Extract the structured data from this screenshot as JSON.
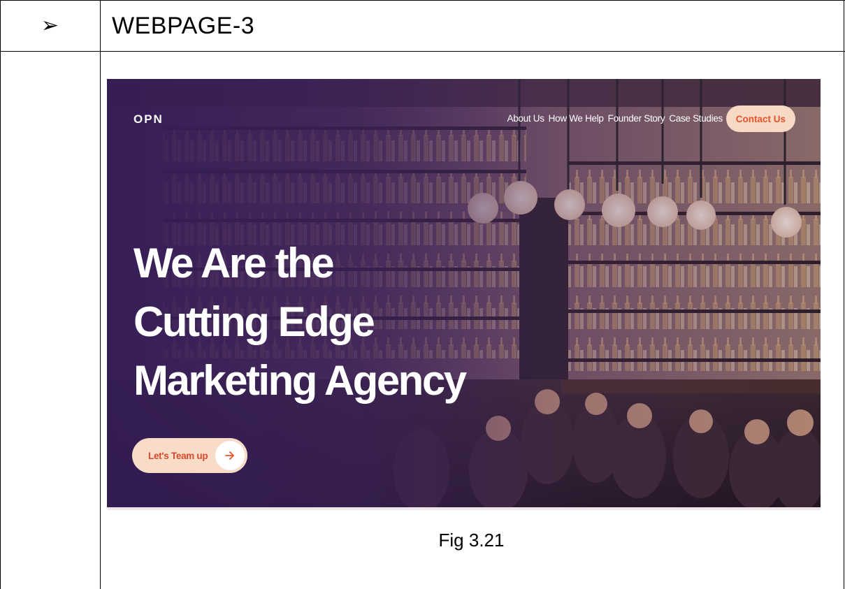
{
  "document": {
    "bullet_glyph": "➢",
    "heading": "WEBPAGE-3",
    "caption": "Fig 3.21"
  },
  "website": {
    "logo": "OPN",
    "nav": {
      "links": [
        "About Us",
        "How We Help",
        "Founder Story",
        "Case Studies"
      ],
      "contact_label": "Contact Us"
    },
    "hero": {
      "title_lines": [
        "We Are the",
        "Cutting Edge",
        "Marketing Agency"
      ],
      "cta_label": "Let's Team up",
      "cta_icon": "arrow-right-icon"
    },
    "colors": {
      "overlay": "#3a2058",
      "accent": "#e4532a",
      "button_bg": "#f7d9c6"
    }
  }
}
